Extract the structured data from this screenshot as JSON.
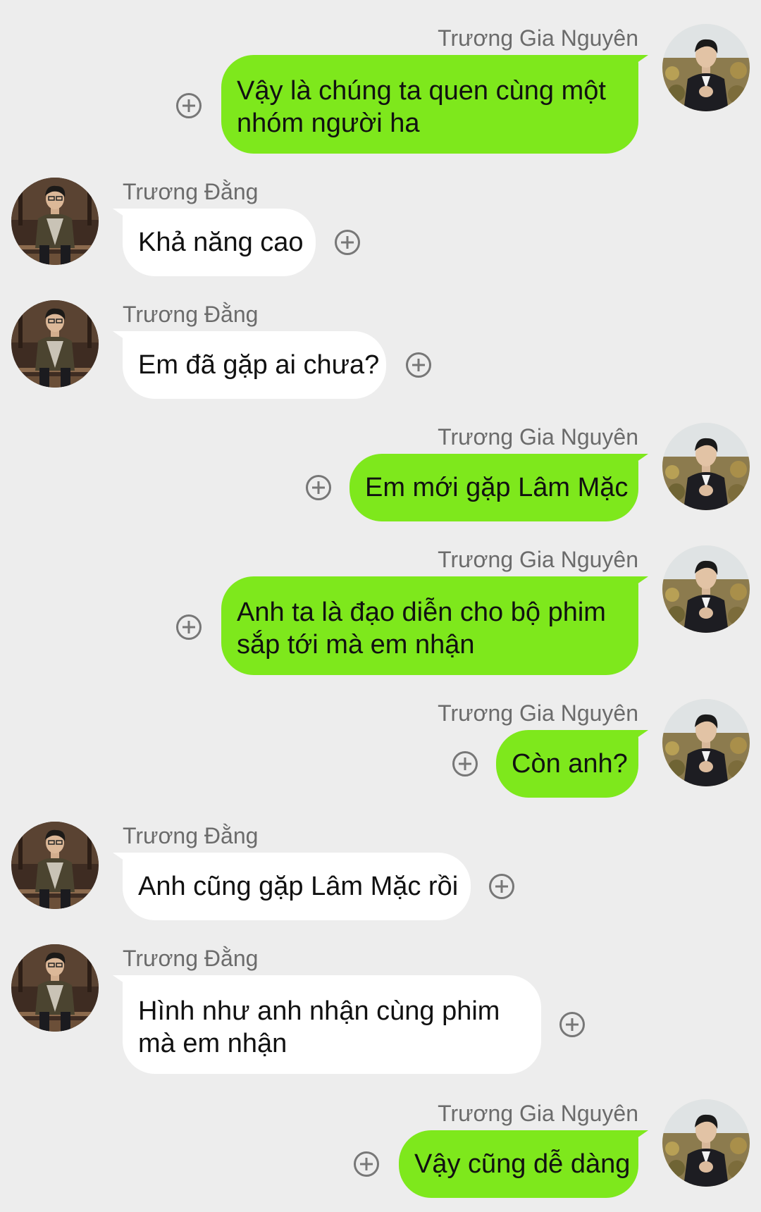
{
  "contacts": {
    "me": {
      "name": "Trương Gia Nguyên",
      "avatar_icon": "profile-photo-man-in-dark-suit"
    },
    "other": {
      "name": "Trương Đằng",
      "avatar_icon": "profile-photo-man-sitting-on-wooden-steps"
    }
  },
  "colors": {
    "background": "#ededed",
    "outgoing_bubble": "#7ee81c",
    "incoming_bubble": "#ffffff",
    "sender_name": "#6b6b6b",
    "add_icon": "#777777"
  },
  "messages": [
    {
      "direction": "out",
      "sender": "Trương Gia Nguyên",
      "lines": [
        "Vậy là chúng ta quen cùng một",
        "nhóm người ha"
      ]
    },
    {
      "direction": "in",
      "sender": "Trương Đằng",
      "lines": [
        "Khả năng cao"
      ]
    },
    {
      "direction": "in",
      "sender": "Trương Đằng",
      "lines": [
        "Em đã gặp ai chưa?"
      ]
    },
    {
      "direction": "out",
      "sender": "Trương Gia Nguyên",
      "lines": [
        "Em mới gặp Lâm Mặc"
      ]
    },
    {
      "direction": "out",
      "sender": "Trương Gia Nguyên",
      "lines": [
        "Anh ta là đạo diễn cho bộ phim",
        "sắp tới mà em nhận"
      ]
    },
    {
      "direction": "out",
      "sender": "Trương Gia Nguyên",
      "lines": [
        "Còn anh?"
      ]
    },
    {
      "direction": "in",
      "sender": "Trương Đằng",
      "lines": [
        "Anh cũng gặp Lâm Mặc rồi"
      ]
    },
    {
      "direction": "in",
      "sender": "Trương Đằng",
      "lines": [
        "Hình như anh nhận cùng phim",
        "mà em nhận"
      ]
    },
    {
      "direction": "out",
      "sender": "Trương Gia Nguyên",
      "lines": [
        "Vậy cũng dễ dàng"
      ]
    }
  ]
}
